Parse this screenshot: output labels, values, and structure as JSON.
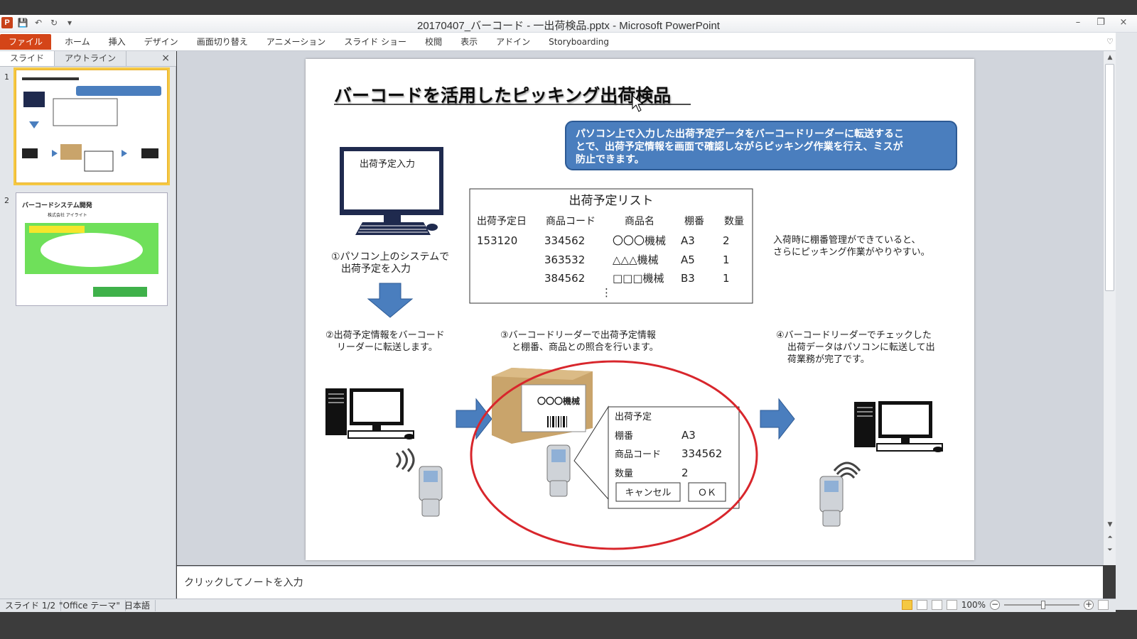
{
  "window": {
    "title": "20170407_バーコード - 一出荷検品.pptx - Microsoft PowerPoint",
    "controls": [
      "–",
      "❐",
      "×"
    ]
  },
  "ribbon": {
    "file_tab": "ファイル",
    "tabs": [
      "ホーム",
      "挿入",
      "デザイン",
      "画面切り替え",
      "アニメーション",
      "スライド ショー",
      "校閲",
      "表示",
      "アドイン",
      "Storyboarding"
    ]
  },
  "panel": {
    "tabs": [
      "スライド",
      "アウトライン"
    ],
    "close": "×",
    "slide_numbers": [
      "1",
      "2"
    ]
  },
  "thumb2": {
    "title": "バーコードシステム開発",
    "company": "株式会社 アイライト"
  },
  "slide": {
    "title": "バーコードを活用したピッキング出荷検品",
    "callout": [
      "パソコン上で入力した出荷予定データをバーコードリーダーに転送するこ",
      "とで、出荷予定情報を画面で確認しながらピッキング作業を行え、ミスが",
      "防止できます。"
    ],
    "monitor_label": "出荷予定入力",
    "step1": [
      "①パソコン上のシステムで",
      "出荷予定を入力"
    ],
    "list": {
      "title": "出荷予定リスト",
      "headers": [
        "出荷予定日",
        "商品コード",
        "商品名",
        "棚番",
        "数量"
      ],
      "rows": [
        [
          "153120",
          "334562",
          "〇〇〇機械",
          "A3",
          "2"
        ],
        [
          "",
          "363532",
          "△△△機械",
          "A5",
          "1"
        ],
        [
          "",
          "384562",
          "□□□機械",
          "B3",
          "1"
        ]
      ],
      "more": "⋮"
    },
    "note": [
      "入荷時に棚番管理ができていると、",
      "さらにピッキング作業がやりやすい。"
    ],
    "step2": [
      "②出荷予定情報をバーコード",
      "リーダーに転送します。"
    ],
    "step3": [
      "③バーコードリーダーで出荷予定情報",
      "と棚番、商品との照合を行います。"
    ],
    "step4": [
      "④バーコードリーダーでチェックした",
      "出荷データはパソコンに転送して出",
      "荷業務が完了です。"
    ],
    "box_label": "〇〇〇機械",
    "screen": {
      "title": "出荷予定",
      "rows": [
        [
          "棚番",
          "A3"
        ],
        [
          "商品コード",
          "334562"
        ],
        [
          "数量",
          "2"
        ]
      ],
      "cancel": "キャンセル",
      "ok": "ＯＫ"
    }
  },
  "notes": {
    "placeholder": "クリックしてノートを入力"
  },
  "status": {
    "slide": "スライド 1/2",
    "theme": "\"Office テーマ\"",
    "language": "日本語",
    "zoom": "100%",
    "zoom_minus": "−",
    "zoom_plus": "+"
  },
  "colors": {
    "file_tab": "#d44518",
    "callout": "#4a7ebe",
    "arrow": "#4a7ebe",
    "circle": "#d8262c",
    "monitor": "#1f2a4e"
  }
}
